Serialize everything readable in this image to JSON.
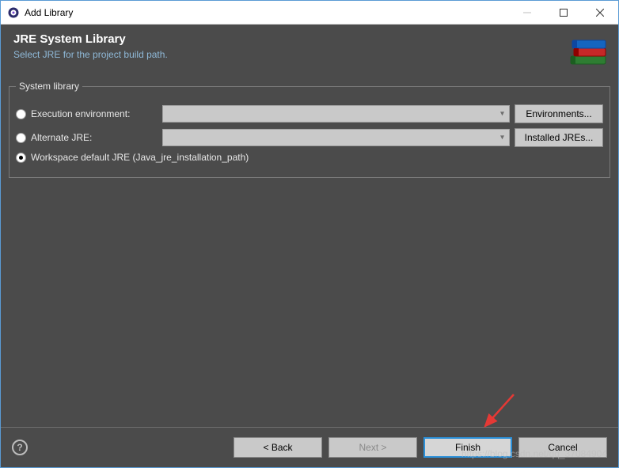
{
  "window": {
    "title": "Add Library"
  },
  "banner": {
    "heading": "JRE System Library",
    "subheading": "Select JRE for the project build path."
  },
  "fieldset": {
    "legend": "System library",
    "options": {
      "exec_env_label": "Execution environment:",
      "alt_jre_label": "Alternate JRE:",
      "workspace_default_label": "Workspace default JRE (Java_jre_installation_path)"
    },
    "buttons": {
      "environments": "Environments...",
      "installed_jres": "Installed JREs..."
    },
    "selected": "workspace_default"
  },
  "footer": {
    "back": "< Back",
    "next": "Next >",
    "finish": "Finish",
    "cancel": "Cancel"
  },
  "watermark": "https://blog.csdn.net/qq_37084904"
}
